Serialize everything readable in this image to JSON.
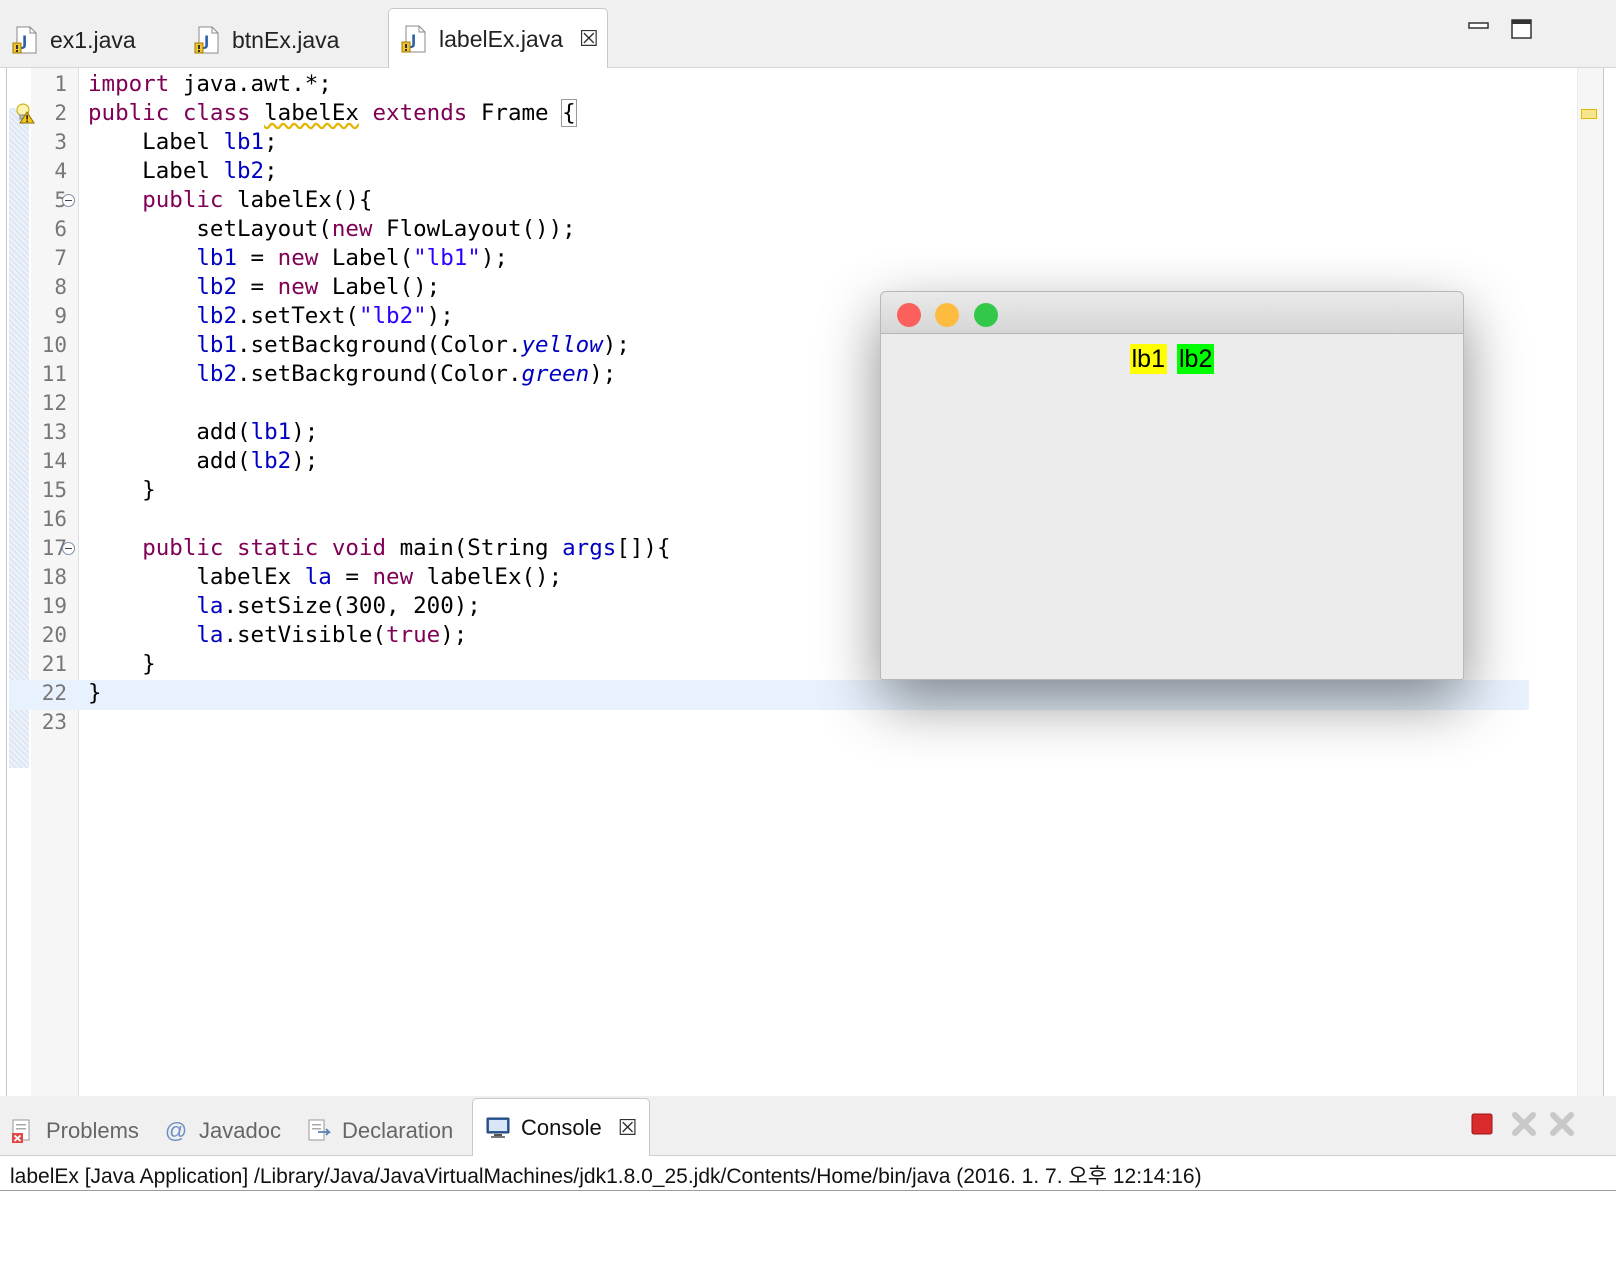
{
  "editor_tabs": [
    {
      "label": "ex1.java",
      "icon": "java-file-icon",
      "active": false
    },
    {
      "label": "btnEx.java",
      "icon": "java-file-icon",
      "active": false
    },
    {
      "label": "labelEx.java",
      "icon": "java-file-icon",
      "active": true,
      "close_icon": "close-icon"
    }
  ],
  "window_controls": [
    "minimize-icon",
    "maximize-icon"
  ],
  "editor": {
    "current_line": 22,
    "warning_line": 2,
    "lines": [
      {
        "num": "1",
        "text": "import java.awt.*;"
      },
      {
        "num": "2",
        "text": "public class labelEx extends Frame {"
      },
      {
        "num": "3",
        "text": "    Label lb1;"
      },
      {
        "num": "4",
        "text": "    Label lb2;"
      },
      {
        "num": "5",
        "text": "    public labelEx(){",
        "fold": true
      },
      {
        "num": "6",
        "text": "        setLayout(new FlowLayout());"
      },
      {
        "num": "7",
        "text": "        lb1 = new Label(\"lb1\");"
      },
      {
        "num": "8",
        "text": "        lb2 = new Label();"
      },
      {
        "num": "9",
        "text": "        lb2.setText(\"lb2\");"
      },
      {
        "num": "10",
        "text": "        lb1.setBackground(Color.yellow);"
      },
      {
        "num": "11",
        "text": "        lb2.setBackground(Color.green);"
      },
      {
        "num": "12",
        "text": ""
      },
      {
        "num": "13",
        "text": "        add(lb1);"
      },
      {
        "num": "14",
        "text": "        add(lb2);"
      },
      {
        "num": "15",
        "text": "    }"
      },
      {
        "num": "16",
        "text": ""
      },
      {
        "num": "17",
        "text": "    public static void main(String args[]){",
        "fold": true
      },
      {
        "num": "18",
        "text": "        labelEx la = new labelEx();"
      },
      {
        "num": "19",
        "text": "        la.setSize(300, 200);"
      },
      {
        "num": "20",
        "text": "        la.setVisible(true);"
      },
      {
        "num": "21",
        "text": "    }"
      },
      {
        "num": "22",
        "text": "}"
      },
      {
        "num": "23",
        "text": ""
      }
    ]
  },
  "app_window": {
    "labels": [
      {
        "text": "lb1",
        "background": "#ffff00"
      },
      {
        "text": "lb2",
        "background": "#00ff00"
      }
    ],
    "traffic_lights": [
      "#fc605c",
      "#fdbc40",
      "#34c84a"
    ]
  },
  "bottom_panel": {
    "tabs": [
      {
        "label": "Problems",
        "icon": "problems-icon",
        "active": false
      },
      {
        "label": "Javadoc",
        "icon": "at-icon",
        "active": false
      },
      {
        "label": "Declaration",
        "icon": "declaration-icon",
        "active": false
      },
      {
        "label": "Console",
        "icon": "console-icon",
        "active": true,
        "close_icon": "close-icon"
      }
    ],
    "console_header": "labelEx [Java Application] /Library/Java/JavaVirtualMachines/jdk1.8.0_25.jdk/Contents/Home/bin/java (2016. 1. 7. 오후 12:14:16)",
    "actions": [
      "terminate-icon",
      "remove-launch-icon",
      "remove-all-icon"
    ]
  },
  "colors": {
    "keyword": "#7f0055",
    "field": "#0000c0",
    "string": "#2a00ff",
    "current_line": "#e8f2fe"
  }
}
